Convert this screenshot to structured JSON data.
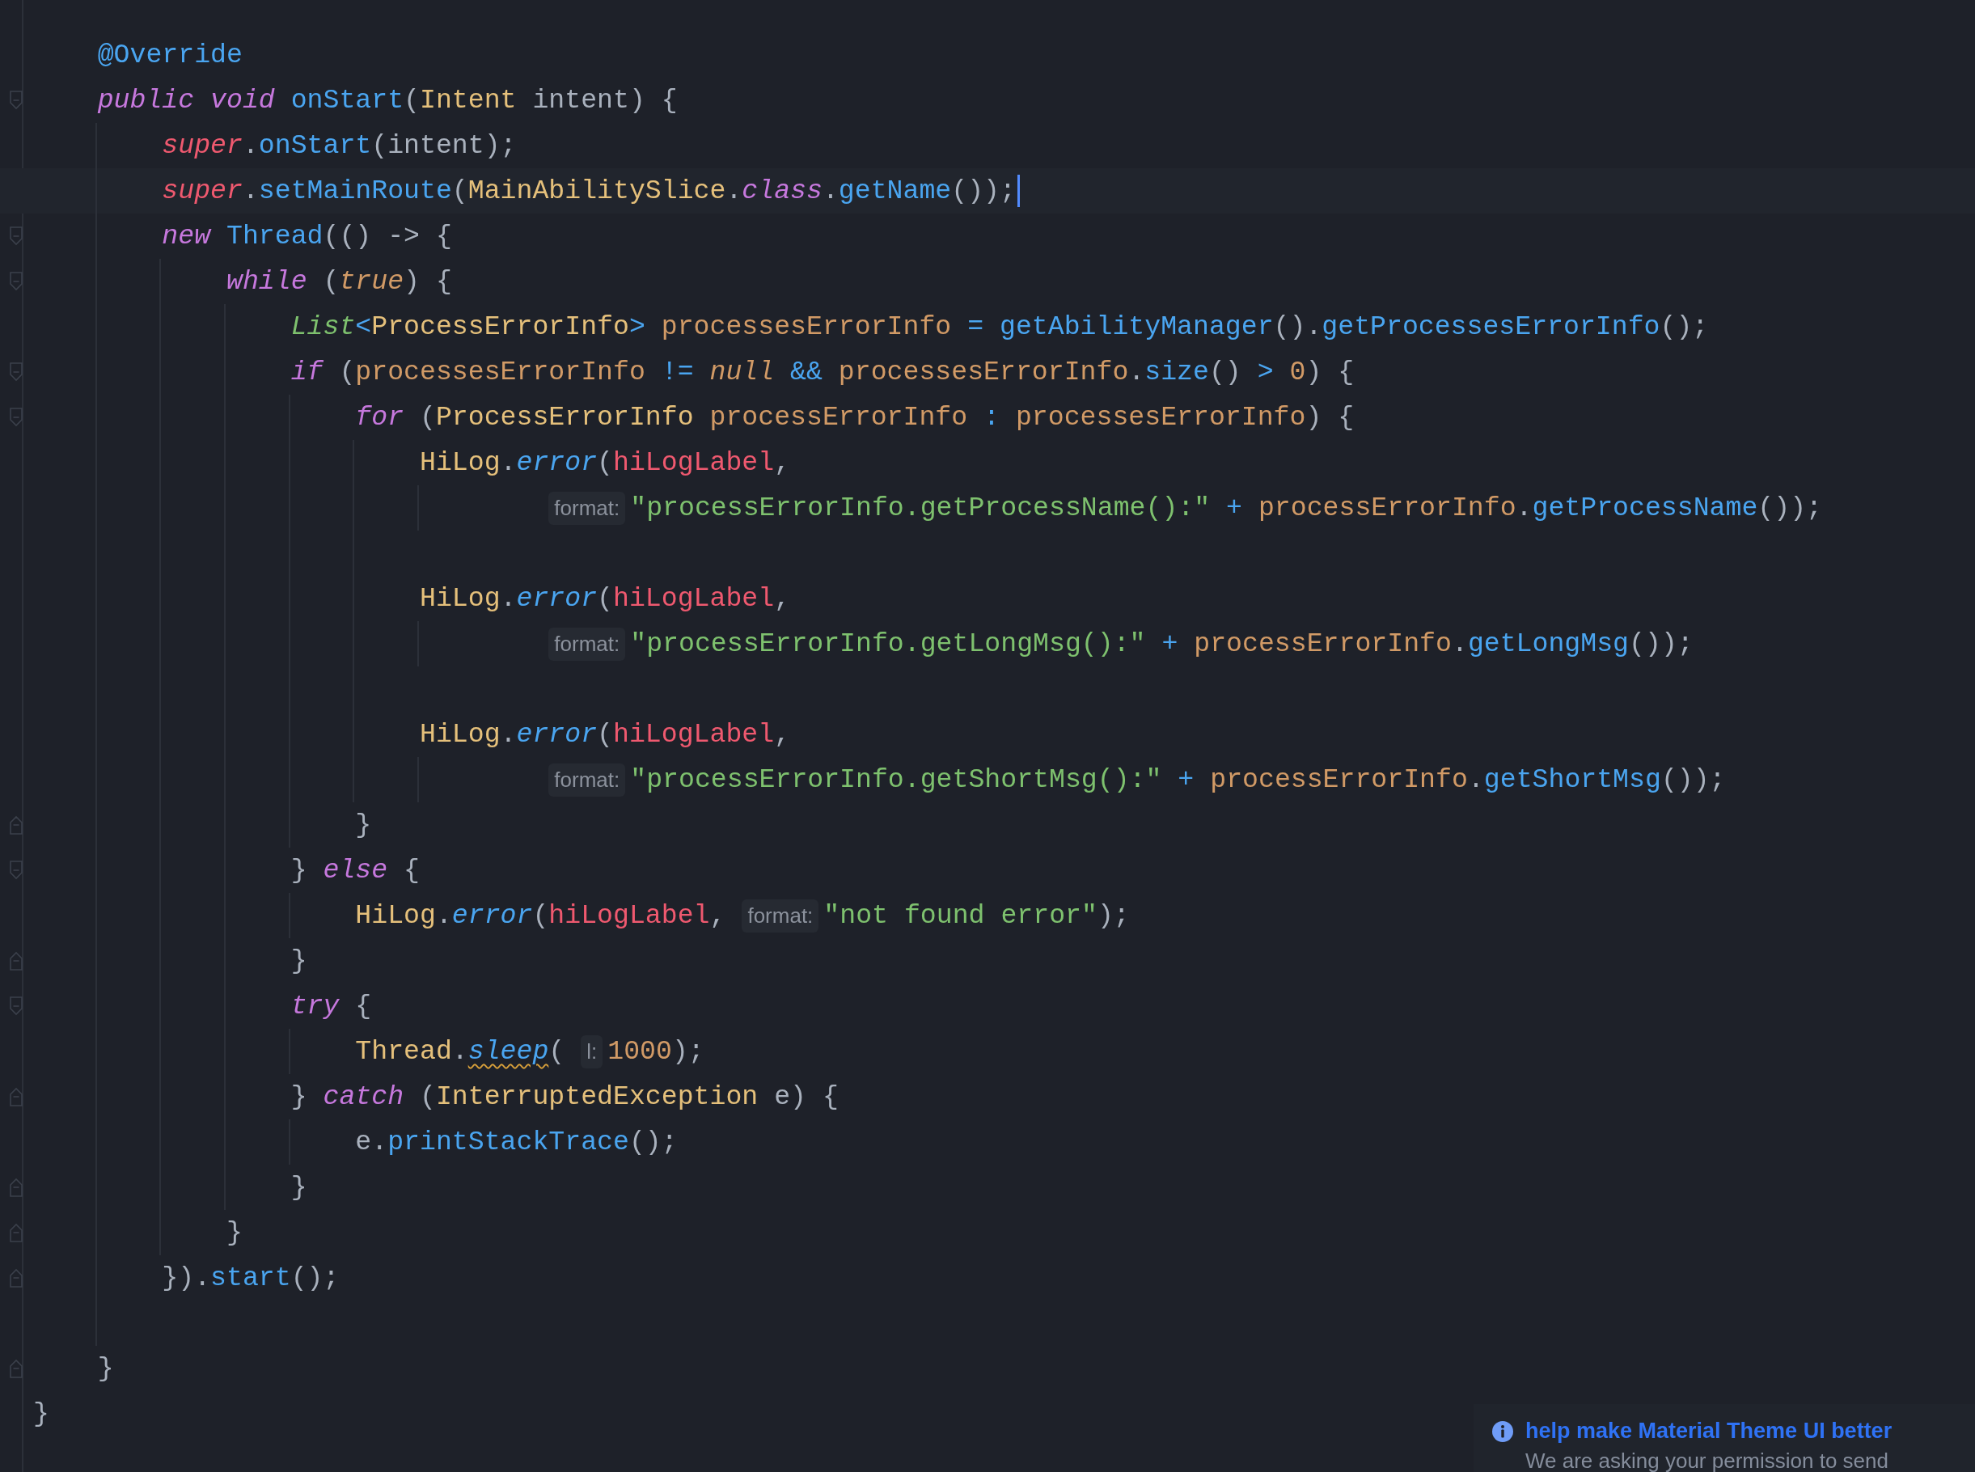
{
  "editor": {
    "members": [
      {
        "tokens": [
          {
            "kind": "annotation",
            "text": "@Override"
          }
        ]
      },
      {
        "fold_start": true,
        "tokens": [
          {
            "kind": "keyword",
            "text": "public"
          },
          {
            "kind": "keyword",
            "text": " void"
          },
          {
            "kind": "function",
            "text": " onStart"
          },
          {
            "kind": "plain",
            "text": "("
          },
          {
            "kind": "type",
            "text": "Intent"
          },
          {
            "kind": "plain",
            "text": " intent) {"
          }
        ],
        "children": [
          {
            "tokens": [
              {
                "kind": "self",
                "text": "super"
              },
              {
                "kind": "plain",
                "text": "."
              },
              {
                "kind": "function",
                "text": "onStart"
              },
              {
                "kind": "plain",
                "text": "(intent);"
              }
            ]
          },
          {
            "current": true,
            "tokens": [
              {
                "kind": "self",
                "text": "super"
              },
              {
                "kind": "plain",
                "text": "."
              },
              {
                "kind": "function",
                "text": "setMainRoute"
              },
              {
                "kind": "plain",
                "text": "("
              },
              {
                "kind": "type",
                "text": "MainAbilitySlice"
              },
              {
                "kind": "plain",
                "text": "."
              },
              {
                "kind": "keyword",
                "text": "class"
              },
              {
                "kind": "plain",
                "text": "."
              },
              {
                "kind": "function",
                "text": "getName"
              },
              {
                "kind": "plain",
                "text": "());"
              }
            ]
          },
          {
            "fold_start": true,
            "tokens": [
              {
                "kind": "keyword",
                "text": "new"
              },
              {
                "kind": "function",
                "text": " Thread"
              },
              {
                "kind": "plain",
                "text": "(() -> {"
              }
            ],
            "children": [
              {
                "fold_start": true,
                "tokens": [
                  {
                    "kind": "keyword",
                    "text": "while"
                  },
                  {
                    "kind": "plain",
                    "text": " ("
                  },
                  {
                    "kind": "constant",
                    "text": "true"
                  },
                  {
                    "kind": "plain",
                    "text": ") {"
                  }
                ],
                "children": [
                  {
                    "tokens": [
                      {
                        "kind": "generic",
                        "text": "List"
                      },
                      {
                        "kind": "operator",
                        "text": "<"
                      },
                      {
                        "kind": "type",
                        "text": "ProcessErrorInfo"
                      },
                      {
                        "kind": "operator",
                        "text": ">"
                      },
                      {
                        "kind": "variable",
                        "text": " processesErrorInfo"
                      },
                      {
                        "kind": "operator",
                        "text": " ="
                      },
                      {
                        "kind": "function",
                        "text": " getAbilityManager"
                      },
                      {
                        "kind": "plain",
                        "text": "()."
                      },
                      {
                        "kind": "function",
                        "text": "getProcessesErrorInfo"
                      },
                      {
                        "kind": "plain",
                        "text": "();"
                      }
                    ]
                  },
                  {
                    "fold_start": true,
                    "tokens": [
                      {
                        "kind": "keyword",
                        "text": "if"
                      },
                      {
                        "kind": "plain",
                        "text": " ("
                      },
                      {
                        "kind": "variable",
                        "text": "processesErrorInfo"
                      },
                      {
                        "kind": "operator",
                        "text": " !="
                      },
                      {
                        "kind": "constant",
                        "text": " null"
                      },
                      {
                        "kind": "operator",
                        "text": " &&"
                      },
                      {
                        "kind": "variable",
                        "text": " processesErrorInfo"
                      },
                      {
                        "kind": "plain",
                        "text": "."
                      },
                      {
                        "kind": "function",
                        "text": "size"
                      },
                      {
                        "kind": "plain",
                        "text": "()"
                      },
                      {
                        "kind": "operator",
                        "text": " >"
                      },
                      {
                        "kind": "number",
                        "text": " 0"
                      },
                      {
                        "kind": "plain",
                        "text": ") {"
                      }
                    ],
                    "children": [
                      {
                        "fold_start": true,
                        "tokens": [
                          {
                            "kind": "keyword",
                            "text": "for"
                          },
                          {
                            "kind": "plain",
                            "text": " ("
                          },
                          {
                            "kind": "type",
                            "text": "ProcessErrorInfo"
                          },
                          {
                            "kind": "variable",
                            "text": " processErrorInfo"
                          },
                          {
                            "kind": "operator",
                            "text": " :"
                          },
                          {
                            "kind": "variable",
                            "text": " processesErrorInfo"
                          },
                          {
                            "kind": "plain",
                            "text": ") {"
                          }
                        ],
                        "children": [
                          {
                            "wrapped": true,
                            "tokens": [
                              {
                                "kind": "type",
                                "text": "HiLog"
                              },
                              {
                                "kind": "plain",
                                "text": "."
                              },
                              {
                                "kind": "method",
                                "text": "error"
                              },
                              {
                                "kind": "plain",
                                "text": "("
                              },
                              {
                                "kind": "field",
                                "text": "hiLogLabel"
                              },
                              {
                                "kind": "plain",
                                "text": ","
                              }
                            ],
                            "children": [
                              {
                                "tokens": [
                                  {
                                    "kind": "hint",
                                    "text": "format:"
                                  },
                                  {
                                    "kind": "string",
                                    "text": "\"processErrorInfo.getProcessName():\""
                                  },
                                  {
                                    "kind": "operator",
                                    "text": " +"
                                  },
                                  {
                                    "kind": "variable",
                                    "text": " processErrorInfo"
                                  },
                                  {
                                    "kind": "plain",
                                    "text": "."
                                  },
                                  {
                                    "kind": "function",
                                    "text": "getProcessName"
                                  },
                                  {
                                    "kind": "plain",
                                    "text": "());"
                                  }
                                ]
                              }
                            ]
                          },
                          {
                            "blank": true
                          },
                          {
                            "wrapped": true,
                            "tokens": [
                              {
                                "kind": "type",
                                "text": "HiLog"
                              },
                              {
                                "kind": "plain",
                                "text": "."
                              },
                              {
                                "kind": "method",
                                "text": "error"
                              },
                              {
                                "kind": "plain",
                                "text": "("
                              },
                              {
                                "kind": "field",
                                "text": "hiLogLabel"
                              },
                              {
                                "kind": "plain",
                                "text": ","
                              }
                            ],
                            "children": [
                              {
                                "tokens": [
                                  {
                                    "kind": "hint",
                                    "text": "format:"
                                  },
                                  {
                                    "kind": "string",
                                    "text": "\"processErrorInfo.getLongMsg():\""
                                  },
                                  {
                                    "kind": "operator",
                                    "text": " +"
                                  },
                                  {
                                    "kind": "variable",
                                    "text": " processErrorInfo"
                                  },
                                  {
                                    "kind": "plain",
                                    "text": "."
                                  },
                                  {
                                    "kind": "function",
                                    "text": "getLongMsg"
                                  },
                                  {
                                    "kind": "plain",
                                    "text": "());"
                                  }
                                ]
                              }
                            ]
                          },
                          {
                            "blank": true
                          },
                          {
                            "wrapped": true,
                            "tokens": [
                              {
                                "kind": "type",
                                "text": "HiLog"
                              },
                              {
                                "kind": "plain",
                                "text": "."
                              },
                              {
                                "kind": "method",
                                "text": "error"
                              },
                              {
                                "kind": "plain",
                                "text": "("
                              },
                              {
                                "kind": "field",
                                "text": "hiLogLabel"
                              },
                              {
                                "kind": "plain",
                                "text": ","
                              }
                            ],
                            "children": [
                              {
                                "tokens": [
                                  {
                                    "kind": "hint",
                                    "text": "format:"
                                  },
                                  {
                                    "kind": "string",
                                    "text": "\"processErrorInfo.getShortMsg():\""
                                  },
                                  {
                                    "kind": "operator",
                                    "text": " +"
                                  },
                                  {
                                    "kind": "variable",
                                    "text": " processErrorInfo"
                                  },
                                  {
                                    "kind": "plain",
                                    "text": "."
                                  },
                                  {
                                    "kind": "function",
                                    "text": "getShortMsg"
                                  },
                                  {
                                    "kind": "plain",
                                    "text": "());"
                                  }
                                ]
                              }
                            ]
                          }
                        ]
                      },
                      {
                        "fold_end": true,
                        "tokens": [
                          {
                            "kind": "plain",
                            "text": "}"
                          }
                        ]
                      }
                    ]
                  },
                  {
                    "fold_start": true,
                    "tokens": [
                      {
                        "kind": "plain",
                        "text": "} "
                      },
                      {
                        "kind": "keyword",
                        "text": "else"
                      },
                      {
                        "kind": "plain",
                        "text": " {"
                      }
                    ],
                    "children": [
                      {
                        "tokens": [
                          {
                            "kind": "type",
                            "text": "HiLog"
                          },
                          {
                            "kind": "plain",
                            "text": "."
                          },
                          {
                            "kind": "method",
                            "text": "error"
                          },
                          {
                            "kind": "plain",
                            "text": "("
                          },
                          {
                            "kind": "field",
                            "text": "hiLogLabel"
                          },
                          {
                            "kind": "plain",
                            "text": ","
                          },
                          {
                            "kind": "hint",
                            "text": "format:"
                          },
                          {
                            "kind": "string",
                            "text": "\"not found error\""
                          },
                          {
                            "kind": "plain",
                            "text": ");"
                          }
                        ]
                      }
                    ]
                  },
                  {
                    "fold_end": true,
                    "tokens": [
                      {
                        "kind": "plain",
                        "text": "}"
                      }
                    ]
                  },
                  {
                    "fold_start": true,
                    "tokens": [
                      {
                        "kind": "keyword",
                        "text": "try"
                      },
                      {
                        "kind": "plain",
                        "text": " {"
                      }
                    ],
                    "children": [
                      {
                        "tokens": [
                          {
                            "kind": "type",
                            "text": "Thread"
                          },
                          {
                            "kind": "plain",
                            "text": "."
                          },
                          {
                            "kind": "method",
                            "text": "sleep",
                            "squiggle": true
                          },
                          {
                            "kind": "plain",
                            "text": "("
                          },
                          {
                            "kind": "hint",
                            "text": "l:"
                          },
                          {
                            "kind": "number",
                            "text": "1000"
                          },
                          {
                            "kind": "plain",
                            "text": ");"
                          }
                        ]
                      }
                    ]
                  },
                  {
                    "fold_end": true,
                    "tokens": [
                      {
                        "kind": "plain",
                        "text": "} "
                      },
                      {
                        "kind": "keyword",
                        "text": "catch"
                      },
                      {
                        "kind": "plain",
                        "text": " ("
                      },
                      {
                        "kind": "type",
                        "text": "InterruptedException"
                      },
                      {
                        "kind": "plain",
                        "text": " e) {"
                      }
                    ],
                    "children": [
                      {
                        "tokens": [
                          {
                            "kind": "plain",
                            "text": "e."
                          },
                          {
                            "kind": "function",
                            "text": "printStackTrace"
                          },
                          {
                            "kind": "plain",
                            "text": "();"
                          }
                        ]
                      }
                    ]
                  },
                  {
                    "fold_end": true,
                    "tokens": [
                      {
                        "kind": "plain",
                        "text": "}"
                      }
                    ]
                  }
                ]
              },
              {
                "fold_end": true,
                "tokens": [
                  {
                    "kind": "plain",
                    "text": "}"
                  }
                ]
              }
            ]
          },
          {
            "fold_end": true,
            "tokens": [
              {
                "kind": "plain",
                "text": "})."
              },
              {
                "kind": "function",
                "text": "start"
              },
              {
                "kind": "plain",
                "text": "();"
              }
            ]
          },
          {
            "blank": true
          }
        ]
      },
      {
        "fold_end": true,
        "tokens": [
          {
            "kind": "plain",
            "text": "}"
          }
        ]
      }
    ],
    "closing_line": {
      "tokens": [
        {
          "kind": "plain",
          "text": "}"
        }
      ]
    }
  },
  "notification": {
    "title": "help make Material Theme UI better",
    "message": "We are asking your permission to send"
  }
}
